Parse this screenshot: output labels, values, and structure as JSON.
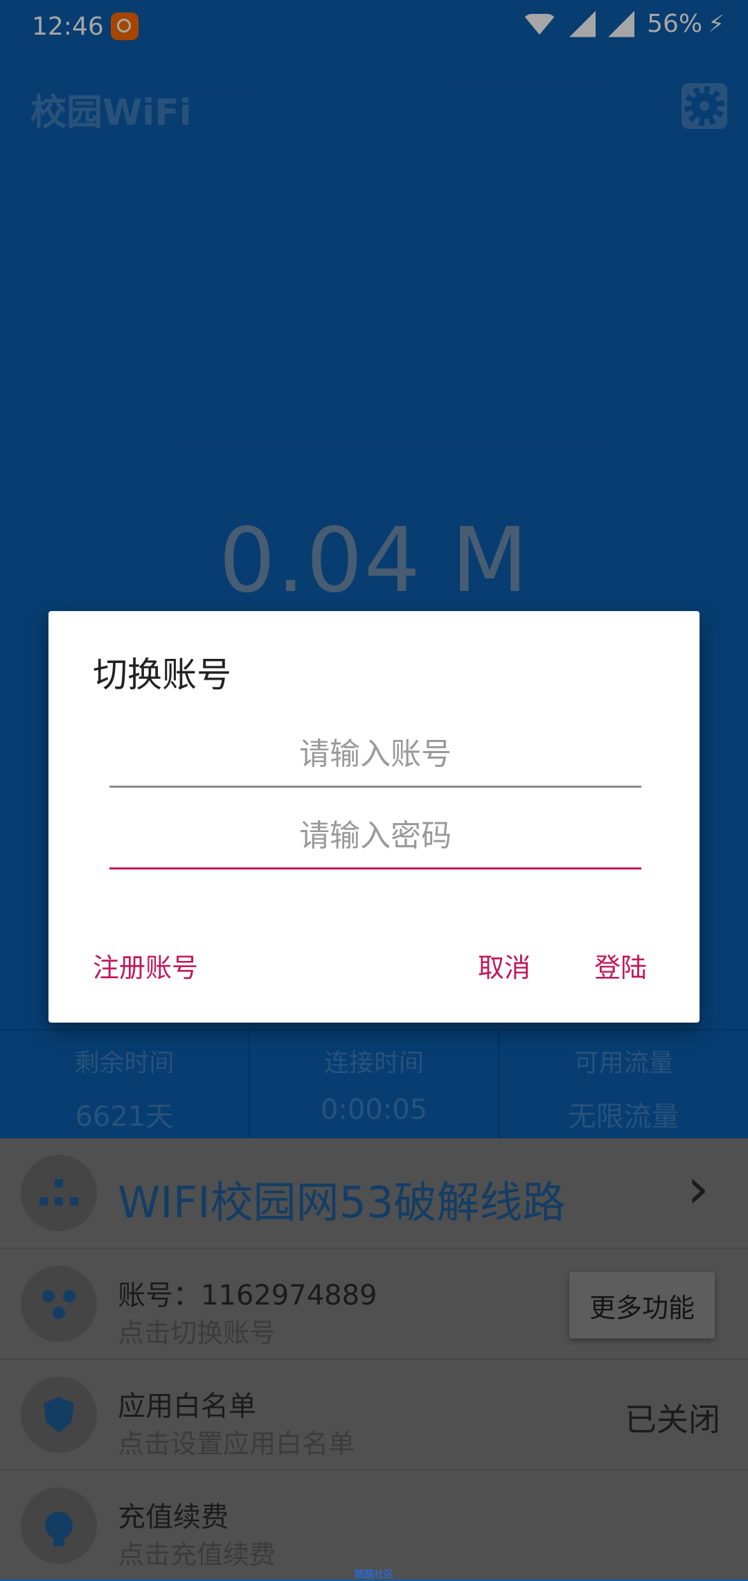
{
  "status_bar": {
    "time": "12:46",
    "battery": "56%"
  },
  "app": {
    "title": "校园WiFi",
    "speed": "0.04 M"
  },
  "stats": [
    {
      "label": "剩余时间",
      "value": "6621天"
    },
    {
      "label": "连接时间",
      "value": "0:00:05"
    },
    {
      "label": "可用流量",
      "value": "无限流量"
    }
  ],
  "list": {
    "route": "WIFI校园网53破解线路",
    "account": {
      "primary": "账号：1162974889",
      "secondary": "点击切换账号",
      "button": "更多功能"
    },
    "whitelist": {
      "primary": "应用白名单",
      "secondary": "点击设置应用白名单",
      "status": "已关闭"
    },
    "recharge": {
      "primary": "充值续费",
      "secondary": "点击充值续费"
    }
  },
  "dialog": {
    "title": "切换账号",
    "account_placeholder": "请输入账号",
    "password_placeholder": "请输入密码",
    "register": "注册账号",
    "cancel": "取消",
    "login": "登陆"
  },
  "watermark": "酷酷社区",
  "icons": {
    "gear": "gear-icon",
    "network": "network-icon",
    "users": "users-icon",
    "shield": "shield-icon",
    "bulb": "bulb-icon"
  },
  "colors": {
    "primary": "#0b5fae",
    "accent": "#c2185b"
  }
}
